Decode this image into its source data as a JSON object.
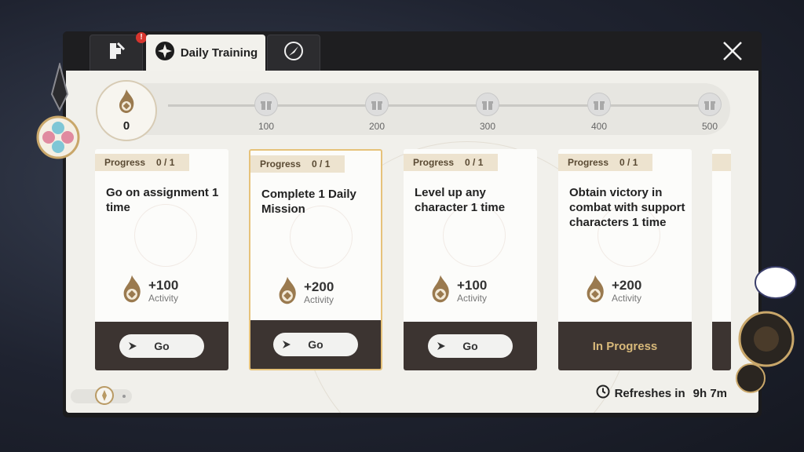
{
  "tabs": [
    {
      "name": "tab-assignments",
      "icon": "puzzle-icon",
      "badge": "!"
    },
    {
      "name": "tab-daily-training",
      "icon": "daily-training-icon",
      "label": "Daily Training",
      "active": true
    },
    {
      "name": "tab-navigation",
      "icon": "compass-icon"
    }
  ],
  "header": {
    "close_icon": "close-icon"
  },
  "progress": {
    "current": "0",
    "start_label": "0",
    "milestones": [
      "100",
      "200",
      "300",
      "400",
      "500"
    ],
    "fill_fraction": 0
  },
  "cards": [
    {
      "progress_label": "Progress",
      "progress_value": "0 / 1",
      "description": "Go on assignment 1 time",
      "reward": "+100",
      "reward_unit": "Activity",
      "action": "Go",
      "state": "go"
    },
    {
      "progress_label": "Progress",
      "progress_value": "0 / 1",
      "description": "Complete 1 Daily Mission",
      "reward": "+200",
      "reward_unit": "Activity",
      "action": "Go",
      "state": "go"
    },
    {
      "progress_label": "Progress",
      "progress_value": "0 / 1",
      "description": "Level up any character 1 time",
      "reward": "+100",
      "reward_unit": "Activity",
      "action": "Go",
      "state": "go"
    },
    {
      "progress_label": "Progress",
      "progress_value": "0 / 1",
      "description": "Obtain victory in combat with support characters 1 time",
      "reward": "+200",
      "reward_unit": "Activity",
      "action": "In Progress",
      "state": "in-progress"
    }
  ],
  "refresh": {
    "label": "Refreshes in",
    "time": "9h 7m"
  },
  "colors": {
    "accent": "#d8b97a",
    "card_dark": "#3c3431",
    "badge": "#d6352e"
  }
}
